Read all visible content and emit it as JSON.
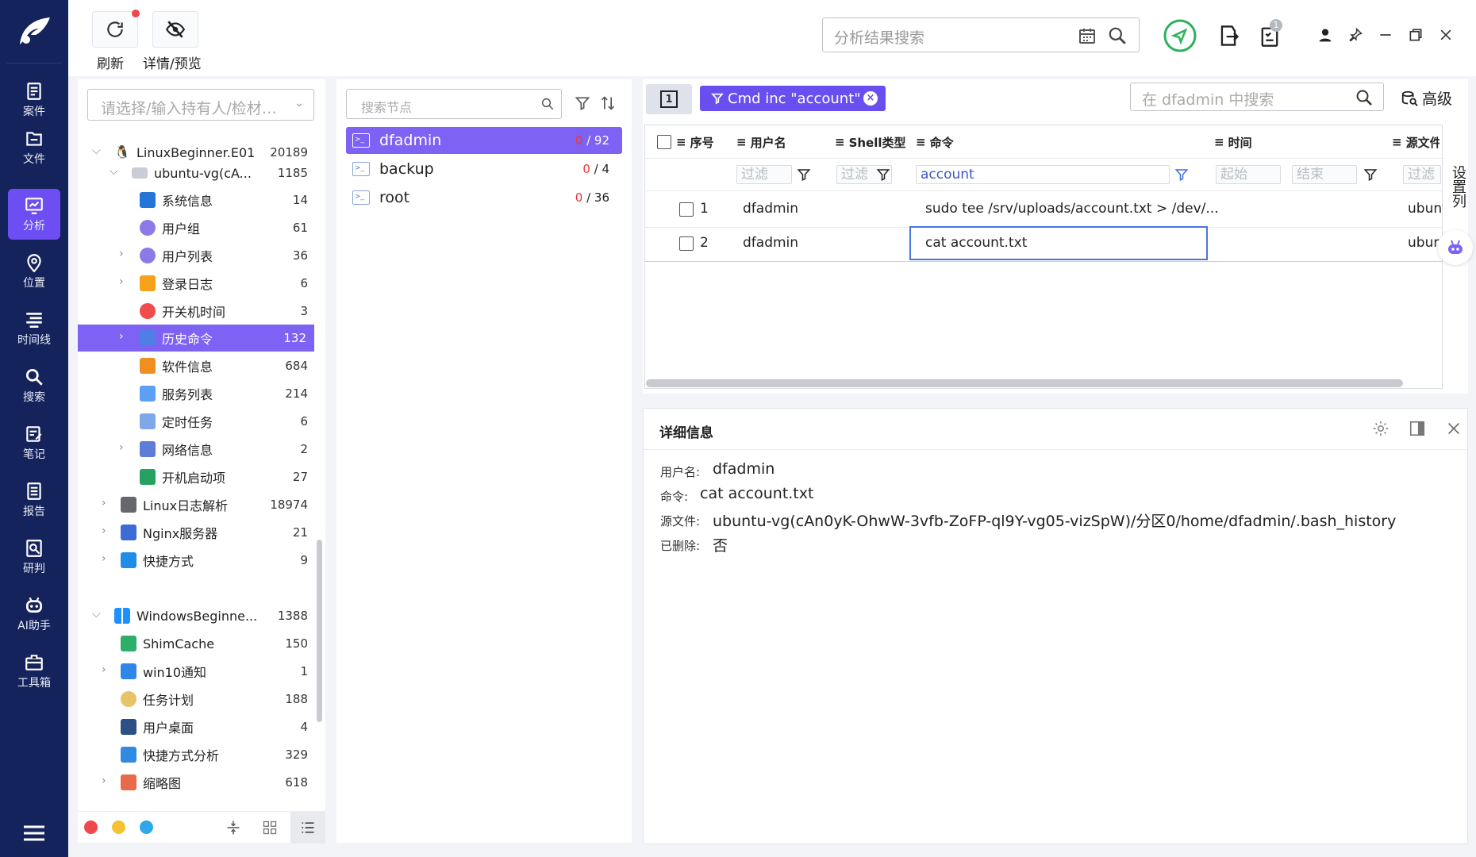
{
  "toolbar": {
    "refresh_label": "刷新",
    "detail_label": "详情/预览"
  },
  "top_search": {
    "placeholder": "分析结果搜索"
  },
  "badge": "1",
  "nav": [
    "案件",
    "文件",
    "分析",
    "位置",
    "时间线",
    "搜索",
    "笔记",
    "报告",
    "研判",
    "AI助手",
    "工具箱"
  ],
  "evidence_select": {
    "placeholder": "请选择/输入持有人/检材…"
  },
  "tree": [
    {
      "label": "LinuxBeginner.E01",
      "count": "20189"
    },
    {
      "label": "ubuntu-vg(cA...",
      "count": "1185"
    },
    {
      "label": "系统信息",
      "count": "14"
    },
    {
      "label": "用户组",
      "count": "61"
    },
    {
      "label": "用户列表",
      "count": "36"
    },
    {
      "label": "登录日志",
      "count": "6"
    },
    {
      "label": "开关机时间",
      "count": "3"
    },
    {
      "label": "历史命令",
      "count": "132"
    },
    {
      "label": "软件信息",
      "count": "684"
    },
    {
      "label": "服务列表",
      "count": "214"
    },
    {
      "label": "定时任务",
      "count": "6"
    },
    {
      "label": "网络信息",
      "count": "2"
    },
    {
      "label": "开机启动项",
      "count": "27"
    },
    {
      "label": "Linux日志解析",
      "count": "18974"
    },
    {
      "label": "Nginx服务器",
      "count": "21"
    },
    {
      "label": "快捷方式",
      "count": "9"
    },
    {
      "label": "WindowsBeginne...",
      "count": "1388"
    },
    {
      "label": "ShimCache",
      "count": "150"
    },
    {
      "label": "win10通知",
      "count": "1"
    },
    {
      "label": "任务计划",
      "count": "188"
    },
    {
      "label": "用户桌面",
      "count": "4"
    },
    {
      "label": "快捷方式分析",
      "count": "329"
    },
    {
      "label": "缩略图",
      "count": "618"
    }
  ],
  "node_search": {
    "placeholder": "搜索节点"
  },
  "nodes": [
    {
      "label": "dfadmin",
      "num": "0",
      "total": "/ 92"
    },
    {
      "label": "backup",
      "num": "0",
      "total": "/ 4"
    },
    {
      "label": "root",
      "num": "0",
      "total": "/ 36"
    }
  ],
  "page_indicator": "1",
  "filter_tag": "Cmd inc \"account\"",
  "grid_search": {
    "placeholder": "在 dfadmin 中搜索"
  },
  "advanced": "高级",
  "columns": {
    "index": "序号",
    "user": "用户名",
    "shell": "Shell类型",
    "cmd": "命令",
    "time": "时间",
    "source": "源文件"
  },
  "filters": {
    "user": "过滤",
    "shell": "过滤",
    "cmd": "account",
    "start": "起始",
    "end": "结束",
    "source": "过滤"
  },
  "rows": [
    {
      "index": "1",
      "user": "dfadmin",
      "cmd": "sudo tee /srv/uploads/account.txt > /dev/...",
      "source": "ubuntu"
    },
    {
      "index": "2",
      "user": "dfadmin",
      "cmd": "cat account.txt",
      "source": "ubur"
    }
  ],
  "side_tab": "设置列",
  "detail": {
    "title": "详细信息",
    "user_label": "用户名:",
    "user": "dfadmin",
    "cmd_label": "命令:",
    "cmd": "cat account.txt",
    "src_label": "源文件:",
    "src": "ubuntu-vg(cAn0yK-OhwW-3vfb-ZoFP-ql9Y-vg05-vizSpW)/分区0/home/dfadmin/.bash_history",
    "del_label": "已删除:",
    "del": "否"
  }
}
